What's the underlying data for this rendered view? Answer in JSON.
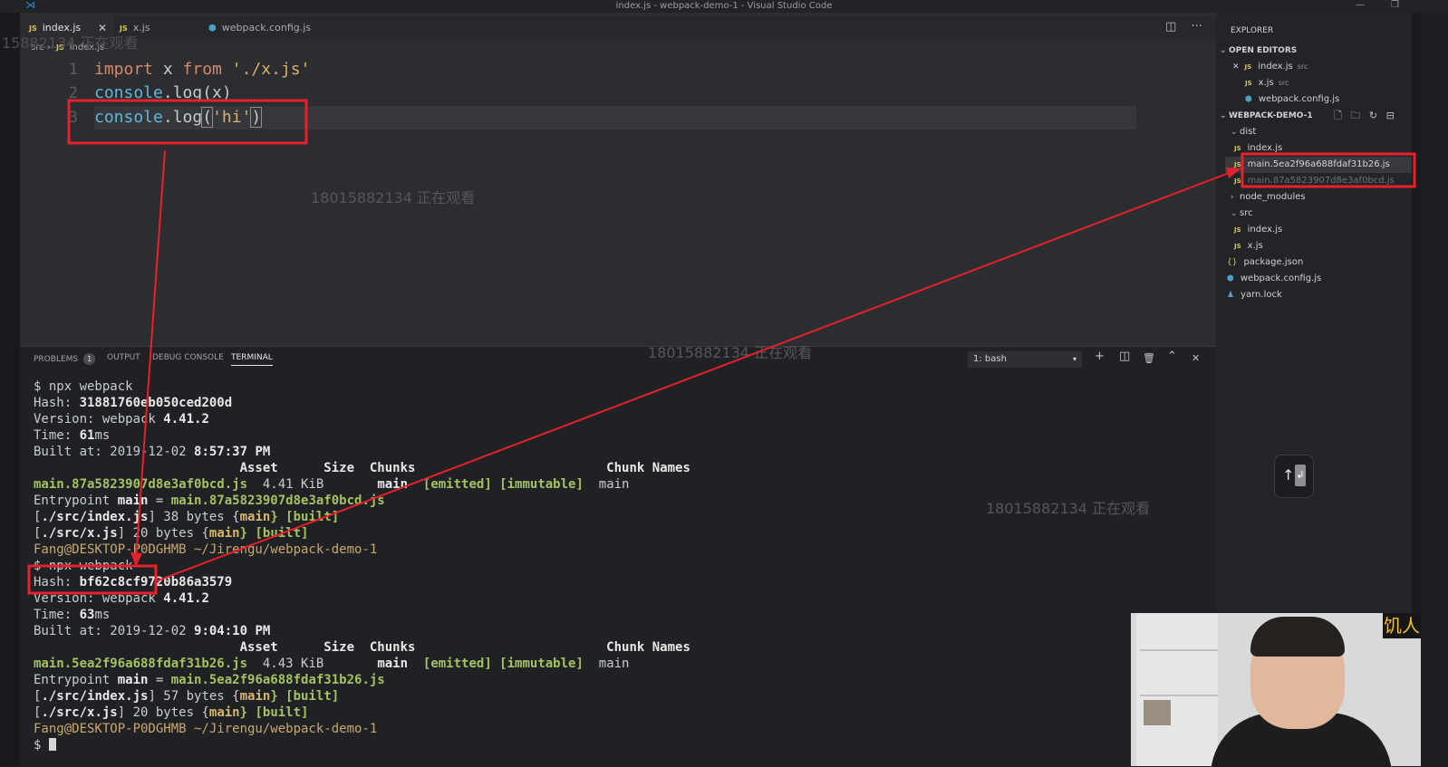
{
  "window": {
    "title": "index.js - webpack-demo-1 - Visual Studio Code",
    "minimize": "—",
    "restore": "❐"
  },
  "tabs": [
    {
      "label": "index.js",
      "icon": "JS",
      "close": "✕"
    },
    {
      "label": "x.js",
      "icon": "JS"
    },
    {
      "label": "webpack.config.js",
      "icon": "⬢"
    }
  ],
  "editor_actions": {
    "split": "◫",
    "more": "···"
  },
  "breadcrumb": {
    "folder": "src",
    "sep": "›",
    "icon": "JS",
    "file": "index.js"
  },
  "code": {
    "line_numbers": [
      "1",
      "2",
      "3"
    ],
    "line1": {
      "kw1": "import",
      "id": " x ",
      "kw2": "from",
      "str": " './x.js'"
    },
    "line2": {
      "fn": "console",
      "rest": ".log(x)"
    },
    "line3": {
      "fn": "console",
      "dot": ".log",
      "open": "(",
      "str": "'hi'",
      "close": ")"
    }
  },
  "watermarks": {
    "w1": "15882134 正在观看",
    "w2": "18015882134 正在观看",
    "w3": "18015882134 正在观看",
    "w4": "18015882134 正在观看"
  },
  "panel": {
    "problems": "PROBLEMS",
    "problems_count": "1",
    "output": "OUTPUT",
    "debug": "DEBUG CONSOLE",
    "terminal": "TERMINAL",
    "shell_select": "1: bash",
    "caret": "▾",
    "add": "+",
    "split": "◫",
    "trash": "🗑",
    "maximize": "⌃",
    "close": "✕"
  },
  "terminal": {
    "cmd1": "$ npx webpack",
    "hash1_label": "Hash: ",
    "hash1": "31881760eb050ced200d",
    "version1_label": "Version: webpack ",
    "version1": "4.41.2",
    "time1_label": "Time: ",
    "time1": "61",
    "time1_unit": "ms",
    "built1_label": "Built at: 2019-12-02 ",
    "built1": "8:57:37 PM",
    "header1": "                           Asset      Size  Chunks                         Chunk Names",
    "asset1": "main.87a5823907d8e3af0bcd.js",
    "asset1_size": "  4.41 KiB       ",
    "asset1_chunk": "main",
    "asset1_flags": "  [emitted] [immutable]",
    "asset1_name": "  main",
    "entry1_label": "Entrypoint ",
    "entry1_main": "main",
    "entry1_eq": " = ",
    "entry1_file": "main.87a5823907d8e3af0bcd.js",
    "mod1a_path": "./src/index.js",
    "mod1a_rest": "] 38 bytes {",
    "mod1b_path": "./src/x.js",
    "mod1b_rest": "] 20 bytes {",
    "mod_main": "main",
    "mod_built": "} [built]",
    "prompt1": "Fang@DESKTOP-P0DGHMB ~/Jirengu/webpack-demo-1",
    "cmd2": "$ npx webpack",
    "hash2_label": "Hash: ",
    "hash2": "bf62c8cf9720b86a3579",
    "version2_label": "Version: webpack ",
    "version2": "4.41.2",
    "time2_label": "Time: ",
    "time2": "63",
    "time2_unit": "ms",
    "built2_label": "Built at: 2019-12-02 ",
    "built2": "9:04:10 PM",
    "header2": "                           Asset      Size  Chunks                         Chunk Names",
    "asset2": "main.5ea2f96a688fdaf31b26.js",
    "asset2_size": "  4.43 KiB       ",
    "asset2_chunk": "main",
    "asset2_flags": "  [emitted] [immutable]",
    "asset2_name": "  main",
    "entry2_label": "Entrypoint ",
    "entry2_main": "main",
    "entry2_eq": " = ",
    "entry2_file": "main.5ea2f96a688fdaf31b26.js",
    "mod2a_path": "./src/index.js",
    "mod2a_rest": "] 57 bytes {",
    "mod2b_path": "./src/x.js",
    "mod2b_rest": "] 20 bytes {",
    "prompt2": "Fang@DESKTOP-P0DGHMB ~/Jirengu/webpack-demo-1",
    "cursor_prompt": "$ "
  },
  "explorer": {
    "title": "EXPLORER",
    "open_editors": "OPEN EDITORS",
    "open": [
      {
        "label": "index.js",
        "sub": "src"
      },
      {
        "label": "x.js",
        "sub": "src"
      },
      {
        "label": "webpack.config.js"
      }
    ],
    "project": "WEBPACK-DEMO-1",
    "dist": "dist",
    "dist_files": [
      "index.js",
      "main.5ea2f96a688fdaf31b26.js",
      "main.87a5823907d8e3af0bcd.js"
    ],
    "node_modules": "node_modules",
    "src": "src",
    "src_files": [
      "index.js",
      "x.js"
    ],
    "root_files": [
      "package.json",
      "webpack.config.js",
      "yarn.lock"
    ],
    "close_x": "✕",
    "icons": {
      "js": "JS",
      "json": "{}",
      "cfg": "⬢",
      "lock": "♟",
      "down": "⌄",
      "right": "›"
    },
    "actions": {
      "new_file": "🗋",
      "new_folder": "🗀",
      "refresh": "↻",
      "collapse": "⊟"
    }
  },
  "overlay": {
    "keyboard_hint": "↑",
    "keyboard_key": "↲",
    "webcam_tag": "饥人"
  },
  "colors": {
    "annotation_red": "#e8202a",
    "string": "#d9b06b",
    "keyword": "#d78a69",
    "function": "#5fb7d6",
    "terminal_green": "#a5c261"
  }
}
